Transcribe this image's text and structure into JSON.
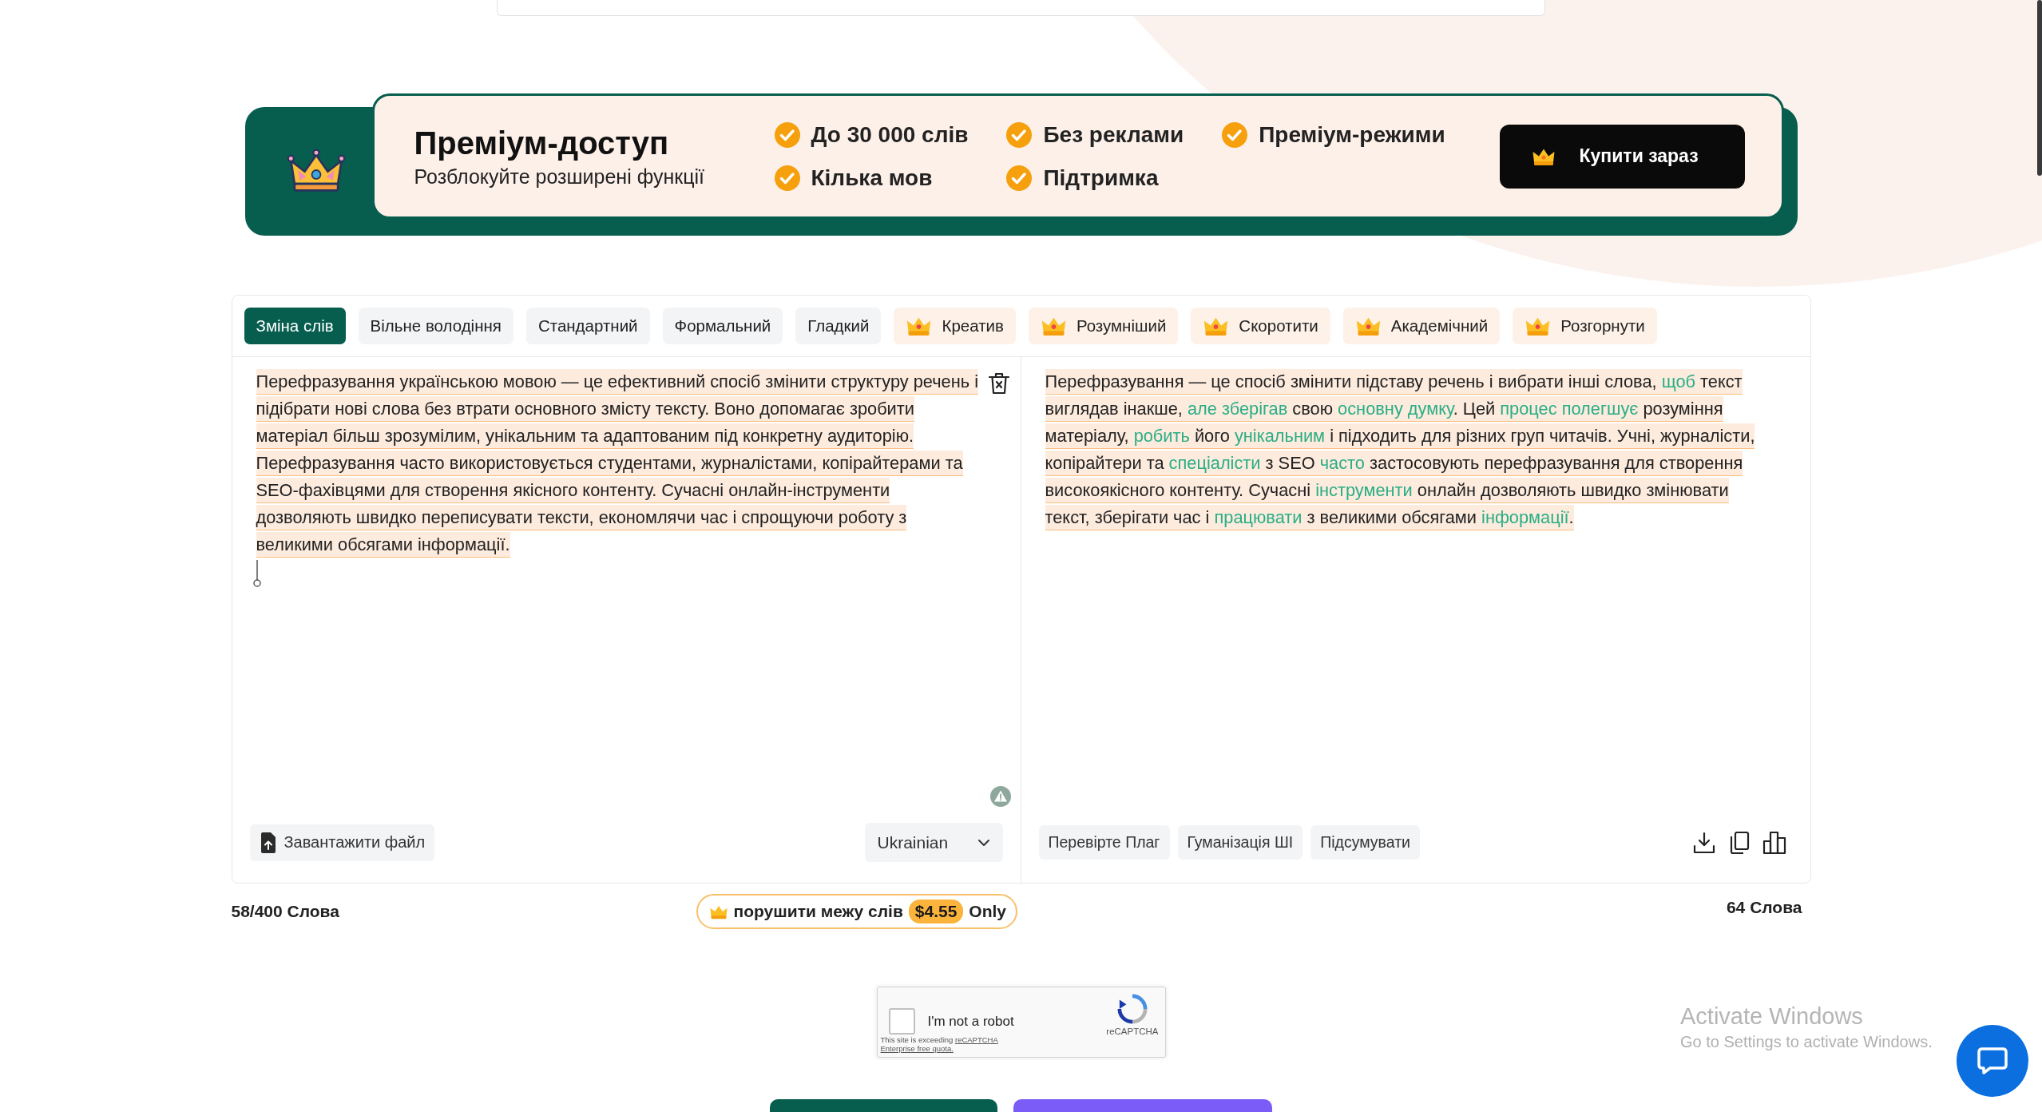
{
  "premium_banner": {
    "title": "Преміум-доступ",
    "subtitle": "Розблокуйте розширені функції",
    "features": [
      "До 30 000 слів",
      "Без реклами",
      "Преміум-режими",
      "Кілька мов",
      "Підтримка"
    ],
    "buy_button": "Купити зараз"
  },
  "modes": [
    {
      "label": "Зміна слів",
      "selected": true,
      "premium": false
    },
    {
      "label": "Вільне володіння",
      "selected": false,
      "premium": false
    },
    {
      "label": "Стандартний",
      "selected": false,
      "premium": false
    },
    {
      "label": "Формальний",
      "selected": false,
      "premium": false
    },
    {
      "label": "Гладкий",
      "selected": false,
      "premium": false
    },
    {
      "label": "Креатив",
      "selected": false,
      "premium": true
    },
    {
      "label": "Розумніший",
      "selected": false,
      "premium": true
    },
    {
      "label": "Скоротити",
      "selected": false,
      "premium": true
    },
    {
      "label": "Академічний",
      "selected": false,
      "premium": true
    },
    {
      "label": "Розгорнути",
      "selected": false,
      "premium": true
    }
  ],
  "input_pane": {
    "text": "Перефразування українською мовою — це ефективний спосіб змінити структуру речень і підібрати нові слова без втрати основного змісту тексту. Воно допомагає зробити матеріал більш зрозумілим, унікальним та адаптованим під конкретну аудиторію. Перефразування часто використовується студентами, журналістами, копірайтерами та SEO-фахівцями для створення якісного контенту. Сучасні онлайн-інструменти дозволяють швидко переписувати тексти, економлячи час і спрощуючи роботу з великими обсягами інформації.",
    "upload_button": "Завантажити файл",
    "language": "Ukrainian"
  },
  "output_pane": {
    "segments": [
      {
        "text": "Перефразування — це спосіб змінити підставу речень і вибрати інші слова, ",
        "changed": false
      },
      {
        "text": "щоб",
        "changed": true
      },
      {
        "text": " текст виглядав інакше, ",
        "changed": false
      },
      {
        "text": "але зберігав",
        "changed": true
      },
      {
        "text": " свою ",
        "changed": false
      },
      {
        "text": "основну думку",
        "changed": true
      },
      {
        "text": ". Цей ",
        "changed": false
      },
      {
        "text": "процес полегшує",
        "changed": true
      },
      {
        "text": " розуміння матеріалу, ",
        "changed": false
      },
      {
        "text": "робить",
        "changed": true
      },
      {
        "text": " його ",
        "changed": false
      },
      {
        "text": "унікальним",
        "changed": true
      },
      {
        "text": " і підходить для різних груп читачів. Учні, журналісти, копірайтери та ",
        "changed": false
      },
      {
        "text": "спеціалісти",
        "changed": true
      },
      {
        "text": " з SEO ",
        "changed": false
      },
      {
        "text": "часто",
        "changed": true
      },
      {
        "text": " застосовують перефразування для створення високоякісного контенту. Сучасні ",
        "changed": false
      },
      {
        "text": "інструменти",
        "changed": true
      },
      {
        "text": " онлайн дозволяють швидко змінювати текст, зберігати час і ",
        "changed": false
      },
      {
        "text": "працювати",
        "changed": true
      },
      {
        "text": " з великими обсягами ",
        "changed": false
      },
      {
        "text": "інформації",
        "changed": true
      },
      {
        "text": ".",
        "changed": false
      }
    ],
    "actions": [
      "Перевірте Плаг",
      "Гуманізація ШІ",
      "Підсумувати"
    ]
  },
  "word_limit": {
    "count": "58/400 Слова",
    "upsell": "порушити межу слів",
    "price": "$4.55",
    "suffix": "Only"
  },
  "output_count": "64 Слова",
  "captcha": {
    "checked": false,
    "label": "I'm not a robot",
    "notice": "This site is exceeding",
    "notice_links": [
      "reCAPTCHA",
      "Enterprise free quota."
    ],
    "brand": "reCAPTCHA"
  },
  "os_notice": {
    "title": "Activate Windows",
    "subtitle": "Go to Settings to activate Windows."
  }
}
